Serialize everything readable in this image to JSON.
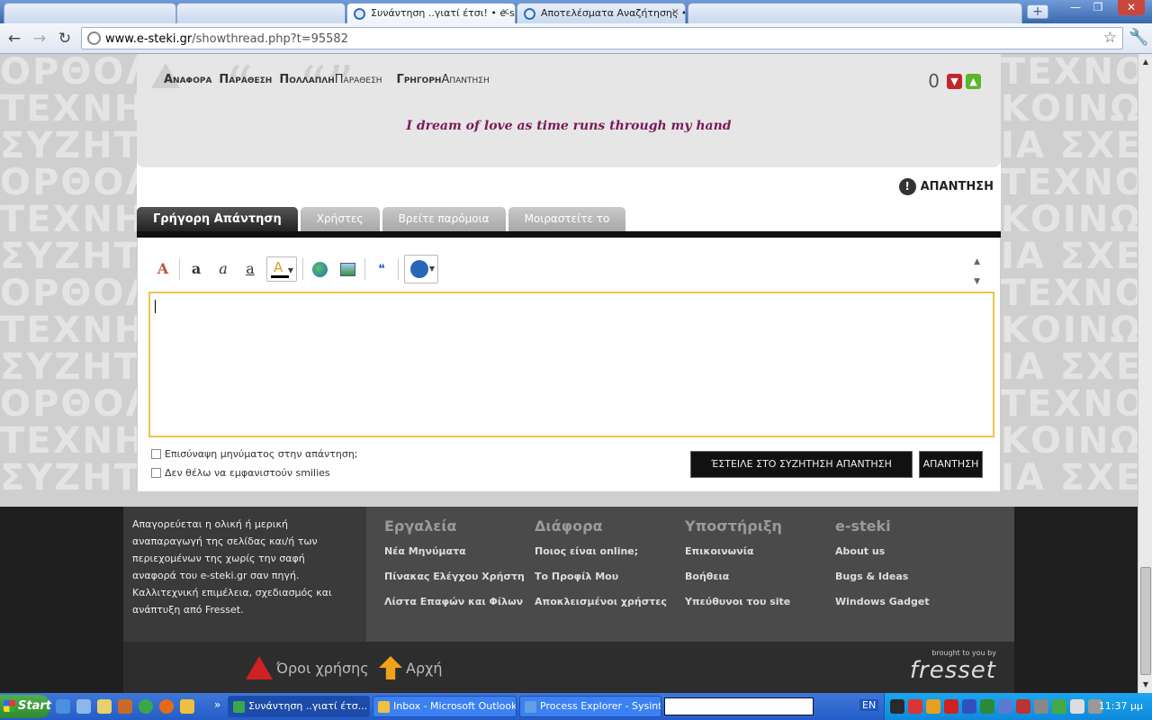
{
  "browser": {
    "tabs": [
      {
        "label": "",
        "type": "blank"
      },
      {
        "label": "",
        "type": "blank"
      },
      {
        "label": "Συνάντηση ..γιατί έτσι! • e-st",
        "active": true
      },
      {
        "label": "Αποτελέσματα Αναζήτησης •"
      },
      {
        "label": "",
        "type": "blank"
      }
    ],
    "new_tab": "+",
    "url_host": "www.e-steki.gr",
    "url_path": "/showthread.php?t=95582",
    "controls": {
      "minimize": "—",
      "maximize": "❐",
      "close": "✕"
    }
  },
  "background_words": {
    "left": "ΟΡΘΟΛ\nΤΕΧΝΗ\nΣΥΖΗΤ\nΟΡΘΟΛ\nΤΕΧΝΗ\nΣΥΖΗΤ\nΟΡΘΟΛ\nΤΕΧΝΗ\nΣΥΖΗΤ\nΟΡΘΟΛ\nΤΕΧΝΗ\nΣΥΖΗΤ",
    "right": "ΤΕΧΝΟ\nΚΟΙΝΩ\nΙΑ ΣΧΕ\nΤΕΧΝΟ\nΚΟΙΝΩ\nΙΑ ΣΧΕ\nΤΕΧΝΟ\nΚΟΙΝΩ\nΙΑ ΣΧΕ\nΤΕΧΝΟ\nΚΟΙΝΩ\nΙΑ ΣΧΕ"
  },
  "post": {
    "actions": {
      "report": "Αναφορα",
      "quote": "Παραθεση",
      "multiquote_bold": "Πολλαπλη",
      "multiquote_thin": "Παραθεση",
      "quickreply_bold": "Γρηγορη",
      "quickreply_thin": "Απαντηση"
    },
    "reputation": "0",
    "signature": "I dream of love as time runs through my hand"
  },
  "reply_link": "ΑΠΑΝΤΗΣΗ",
  "tabs": [
    {
      "label": "Γρήγορη Απάντηση",
      "active": true
    },
    {
      "label": "Χρήστες"
    },
    {
      "label": "Βρείτε παρόμοια"
    },
    {
      "label": "Μοιραστείτε το"
    }
  ],
  "editor": {
    "value": "",
    "options": [
      "Επισύναψη μηνύματος στην απάντηση;",
      "Δεν θέλω να εμφανιστούν smilies"
    ],
    "submit_primary": "ΈΣΤΕΙΛΕ ΣΤΟ ΣΥΖΗΤΗΣΗ ΑΠΑΝΤΗΣΗ",
    "submit_secondary": "ΑΠΑΝΤΗΣΗ"
  },
  "footer": {
    "notice": "Απαγορεύεται η ολική ή μερική αναπαραγωγή της σελίδας και/ή των περιεχομένων της χωρίς την σαφή αναφορά του e-steki.gr σαν πηγή. Καλλιτεχνική επιμέλεια, σχεδιασμός και ανάπτυξη από Fresset.",
    "columns": [
      {
        "title": "Εργαλεία",
        "links": [
          "Νέα Μηνύματα",
          "Πίνακας Ελέγχου Χρήστη",
          "Λίστα Επαφών και Φίλων"
        ]
      },
      {
        "title": "Διάφορα",
        "links": [
          "Ποιος είναι online;",
          "Το Προφίλ Μου",
          "Αποκλεισμένοι χρήστες"
        ]
      },
      {
        "title": "Υποστήριξη",
        "links": [
          "Επικοινωνία",
          "Βοήθεια",
          "Υπεύθυνοι του site"
        ]
      },
      {
        "title": "e-steki",
        "links": [
          "About us",
          "Bugs & Ideas",
          "Windows Gadget"
        ]
      }
    ],
    "terms": "Όροι χρήσης",
    "home": "Αρχή",
    "brought": "brought to you by",
    "brand": "fresset"
  },
  "taskbar": {
    "start": "Start",
    "tasks": [
      {
        "label": "Συνάντηση ..γιατί έτσ...",
        "active": true
      },
      {
        "label": "Inbox - Microsoft Outlook"
      },
      {
        "label": "Process Explorer - Sysint..."
      }
    ],
    "lang": "EN",
    "clock": "11:37 μμ"
  },
  "colors": {
    "accent_signature": "#7a1a5a",
    "textarea_border": "#e8c74d",
    "taskbar": "#245dc8"
  }
}
